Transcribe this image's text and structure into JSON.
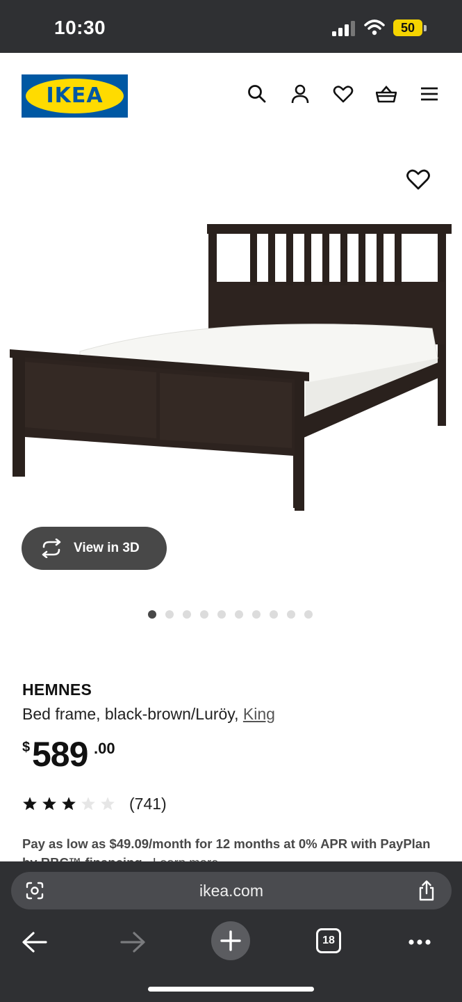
{
  "status_bar": {
    "time": "10:30",
    "battery": "50",
    "battery_color": "#f5d400"
  },
  "header": {
    "logo_text": "IKEA",
    "brand_blue": "#0058a3",
    "brand_yellow": "#ffdb00",
    "icons": [
      "search-icon",
      "account-icon",
      "heart-icon",
      "basket-icon",
      "menu-icon"
    ]
  },
  "gallery": {
    "view3d_label": "View in 3D",
    "slide_count": 10,
    "active_slide": 1
  },
  "product": {
    "name": "HEMNES",
    "description": "Bed frame, black-brown/Luröy, ",
    "size_link": "King",
    "price_currency": "$",
    "price_integer": "589",
    "price_decimal": ".00",
    "rating": 3,
    "rating_max": 5,
    "review_count": "(741)",
    "financing_text": "Pay as low as $49.09/month for 12 months at 0% APR with PayPlan by RBC™ financing.",
    "learn_more": "Learn more"
  },
  "browser": {
    "url": "ikea.com",
    "tab_count": "18"
  }
}
